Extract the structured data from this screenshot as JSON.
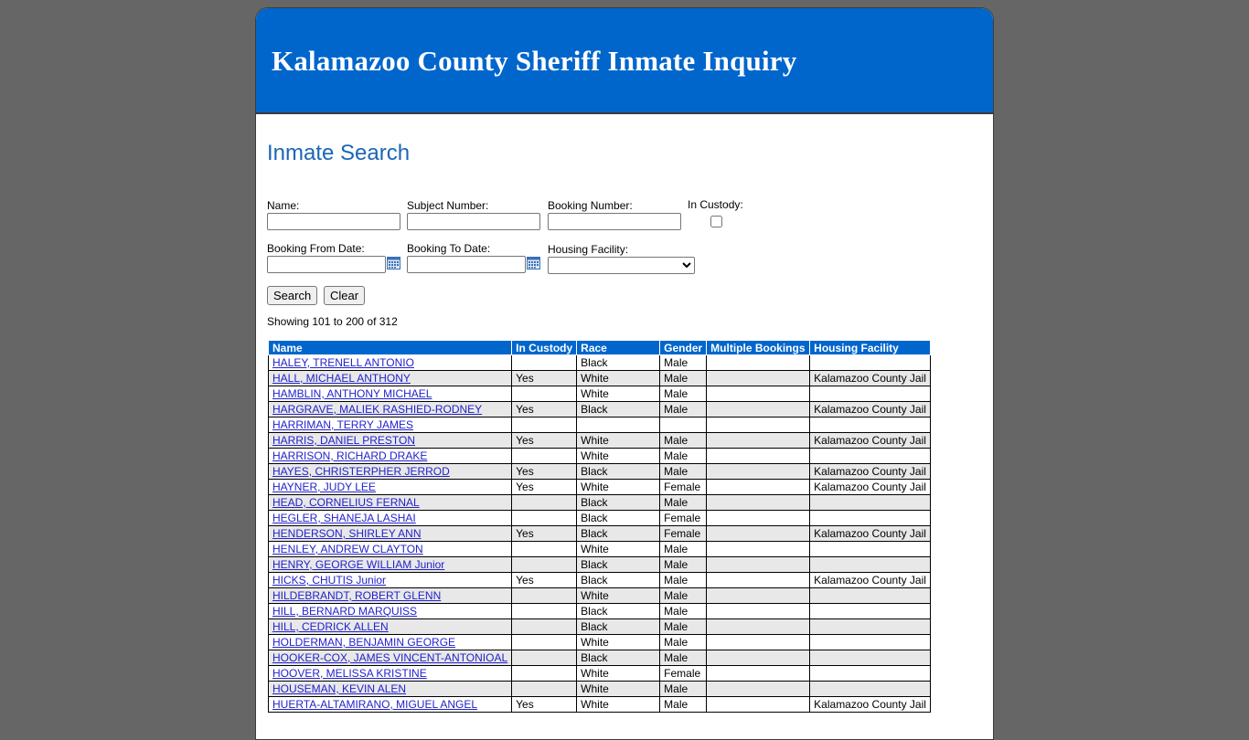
{
  "header": {
    "title": "Kalamazoo County Sheriff Inmate Inquiry"
  },
  "search": {
    "heading": "Inmate Search",
    "name_label": "Name:",
    "subject_label": "Subject Number:",
    "booking_label": "Booking Number:",
    "custody_label": "In Custody:",
    "from_label": "Booking From Date:",
    "to_label": "Booking To Date:",
    "facility_label": "Housing Facility:",
    "search_button": "Search",
    "clear_button": "Clear"
  },
  "results": {
    "showing": "Showing 101 to 200 of 312",
    "columns": [
      "Name",
      "In Custody",
      "Race",
      "Gender",
      "Multiple Bookings",
      "Housing Facility"
    ],
    "rows": [
      [
        "HALEY, TRENELL ANTONIO",
        "",
        "Black",
        "Male",
        "",
        ""
      ],
      [
        "HALL, MICHAEL ANTHONY",
        "Yes",
        "White",
        "Male",
        "",
        "Kalamazoo County Jail"
      ],
      [
        "HAMBLIN, ANTHONY MICHAEL",
        "",
        "White",
        "Male",
        "",
        ""
      ],
      [
        "HARGRAVE, MALIEK RASHIED-RODNEY",
        "Yes",
        "Black",
        "Male",
        "",
        "Kalamazoo County Jail"
      ],
      [
        "HARRIMAN, TERRY JAMES",
        "",
        "",
        "",
        "",
        ""
      ],
      [
        "HARRIS, DANIEL PRESTON",
        "Yes",
        "White",
        "Male",
        "",
        "Kalamazoo County Jail"
      ],
      [
        "HARRISON, RICHARD DRAKE",
        "",
        "White",
        "Male",
        "",
        ""
      ],
      [
        "HAYES, CHRISTERPHER JERROD",
        "Yes",
        "Black",
        "Male",
        "",
        "Kalamazoo County Jail"
      ],
      [
        "HAYNER, JUDY LEE",
        "Yes",
        "White",
        "Female",
        "",
        "Kalamazoo County Jail"
      ],
      [
        "HEAD, CORNELIUS FERNAL",
        "",
        "Black",
        "Male",
        "",
        ""
      ],
      [
        "HEGLER, SHANEJA LASHAI",
        "",
        "Black",
        "Female",
        "",
        ""
      ],
      [
        "HENDERSON, SHIRLEY ANN",
        "Yes",
        "Black",
        "Female",
        "",
        "Kalamazoo County Jail"
      ],
      [
        "HENLEY, ANDREW CLAYTON",
        "",
        "White",
        "Male",
        "",
        ""
      ],
      [
        "HENRY, GEORGE WILLIAM Junior",
        "",
        "Black",
        "Male",
        "",
        ""
      ],
      [
        "HICKS, CHUTIS Junior",
        "Yes",
        "Black",
        "Male",
        "",
        "Kalamazoo County Jail"
      ],
      [
        "HILDEBRANDT, ROBERT GLENN",
        "",
        "White",
        "Male",
        "",
        ""
      ],
      [
        "HILL, BERNARD MARQUISS",
        "",
        "Black",
        "Male",
        "",
        ""
      ],
      [
        "HILL, CEDRICK ALLEN",
        "",
        "Black",
        "Male",
        "",
        ""
      ],
      [
        "HOLDERMAN, BENJAMIN GEORGE",
        "",
        "White",
        "Male",
        "",
        ""
      ],
      [
        "HOOKER-COX, JAMES VINCENT-ANTONIOAL",
        "",
        "Black",
        "Male",
        "",
        ""
      ],
      [
        "HOOVER, MELISSA KRISTINE",
        "",
        "White",
        "Female",
        "",
        ""
      ],
      [
        "HOUSEMAN, KEVIN ALEN",
        "",
        "White",
        "Male",
        "",
        ""
      ],
      [
        "HUERTA-ALTAMIRANO, MIGUEL ANGEL",
        "Yes",
        "White",
        "Male",
        "",
        "Kalamazoo County Jail"
      ]
    ]
  },
  "colors": {
    "banner": "#0066cc",
    "heading": "#1a66b8",
    "page_background": "#666666"
  }
}
